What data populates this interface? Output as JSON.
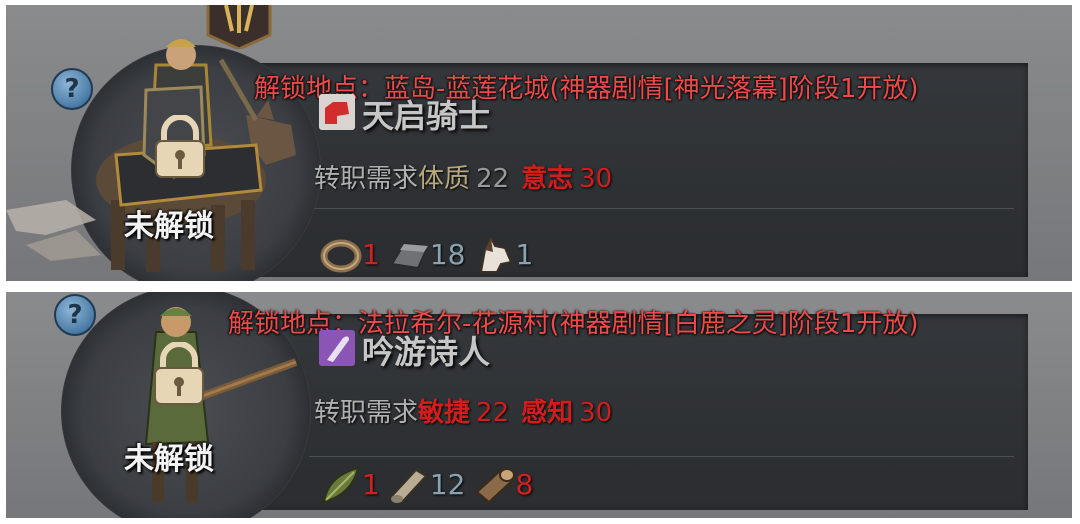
{
  "cards": [
    {
      "lock_label": "未解锁",
      "location": "解锁地点：蓝岛-蓝莲花城(神器剧情[神光落幕]阶段1开放)",
      "class_name": "天启骑士",
      "requirement_label": "转职需求",
      "stats": [
        {
          "name": "体质",
          "value": "22",
          "met": true
        },
        {
          "name": "意志",
          "value": "30",
          "met": false
        }
      ],
      "materials": [
        {
          "icon": "ring-icon",
          "count": "1",
          "status": "insufficient"
        },
        {
          "icon": "ingot-icon",
          "count": "18",
          "status": "sufficient"
        },
        {
          "icon": "horse-head-icon",
          "count": "1",
          "status": "sufficient"
        }
      ]
    },
    {
      "lock_label": "未解锁",
      "location": "解锁地点：法拉希尔-花源村(神器剧情[白鹿之灵]阶段1开放)",
      "class_name": "吟游诗人",
      "requirement_label": "转职需求",
      "stats": [
        {
          "name": "敏捷",
          "value": "22",
          "met": false
        },
        {
          "name": "感知",
          "value": "30",
          "met": false
        }
      ],
      "materials": [
        {
          "icon": "leaf-icon",
          "count": "1",
          "status": "insufficient"
        },
        {
          "icon": "scroll-icon",
          "count": "12",
          "status": "sufficient"
        },
        {
          "icon": "wood-log-icon",
          "count": "8",
          "status": "insufficient"
        }
      ]
    }
  ],
  "colors": {
    "locked_text": "#ee4a4a",
    "insufficient": "#d21d1d",
    "sufficient": "#8aa3b2",
    "met_stat": "#b8a77a",
    "panel": "#2e3134"
  }
}
